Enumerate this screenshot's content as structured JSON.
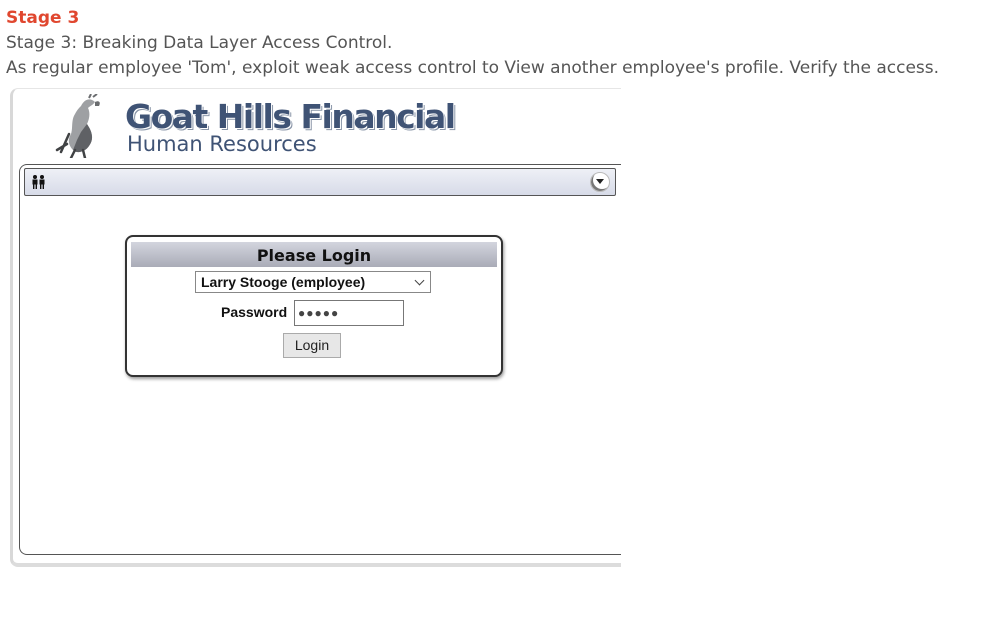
{
  "lesson": {
    "stage_title": "Stage 3",
    "line1": "Stage 3: Breaking Data Layer Access Control.",
    "line2": "As regular employee 'Tom', exploit weak access control to View another employee's profile. Verify the access."
  },
  "app": {
    "brand_title": "Goat Hills Financial",
    "brand_subtitle": "Human Resources",
    "menu_icon": "people-icon",
    "toggle_icon": "chevron-down-circle-icon"
  },
  "login": {
    "header": "Please Login",
    "selected_user": "Larry Stooge (employee)",
    "password_label": "Password",
    "password_mask": "●●●●●",
    "button_label": "Login"
  },
  "colors": {
    "stage_title": "#e0472f",
    "brand": "#3f5375",
    "login_header": "#b8bac6"
  }
}
